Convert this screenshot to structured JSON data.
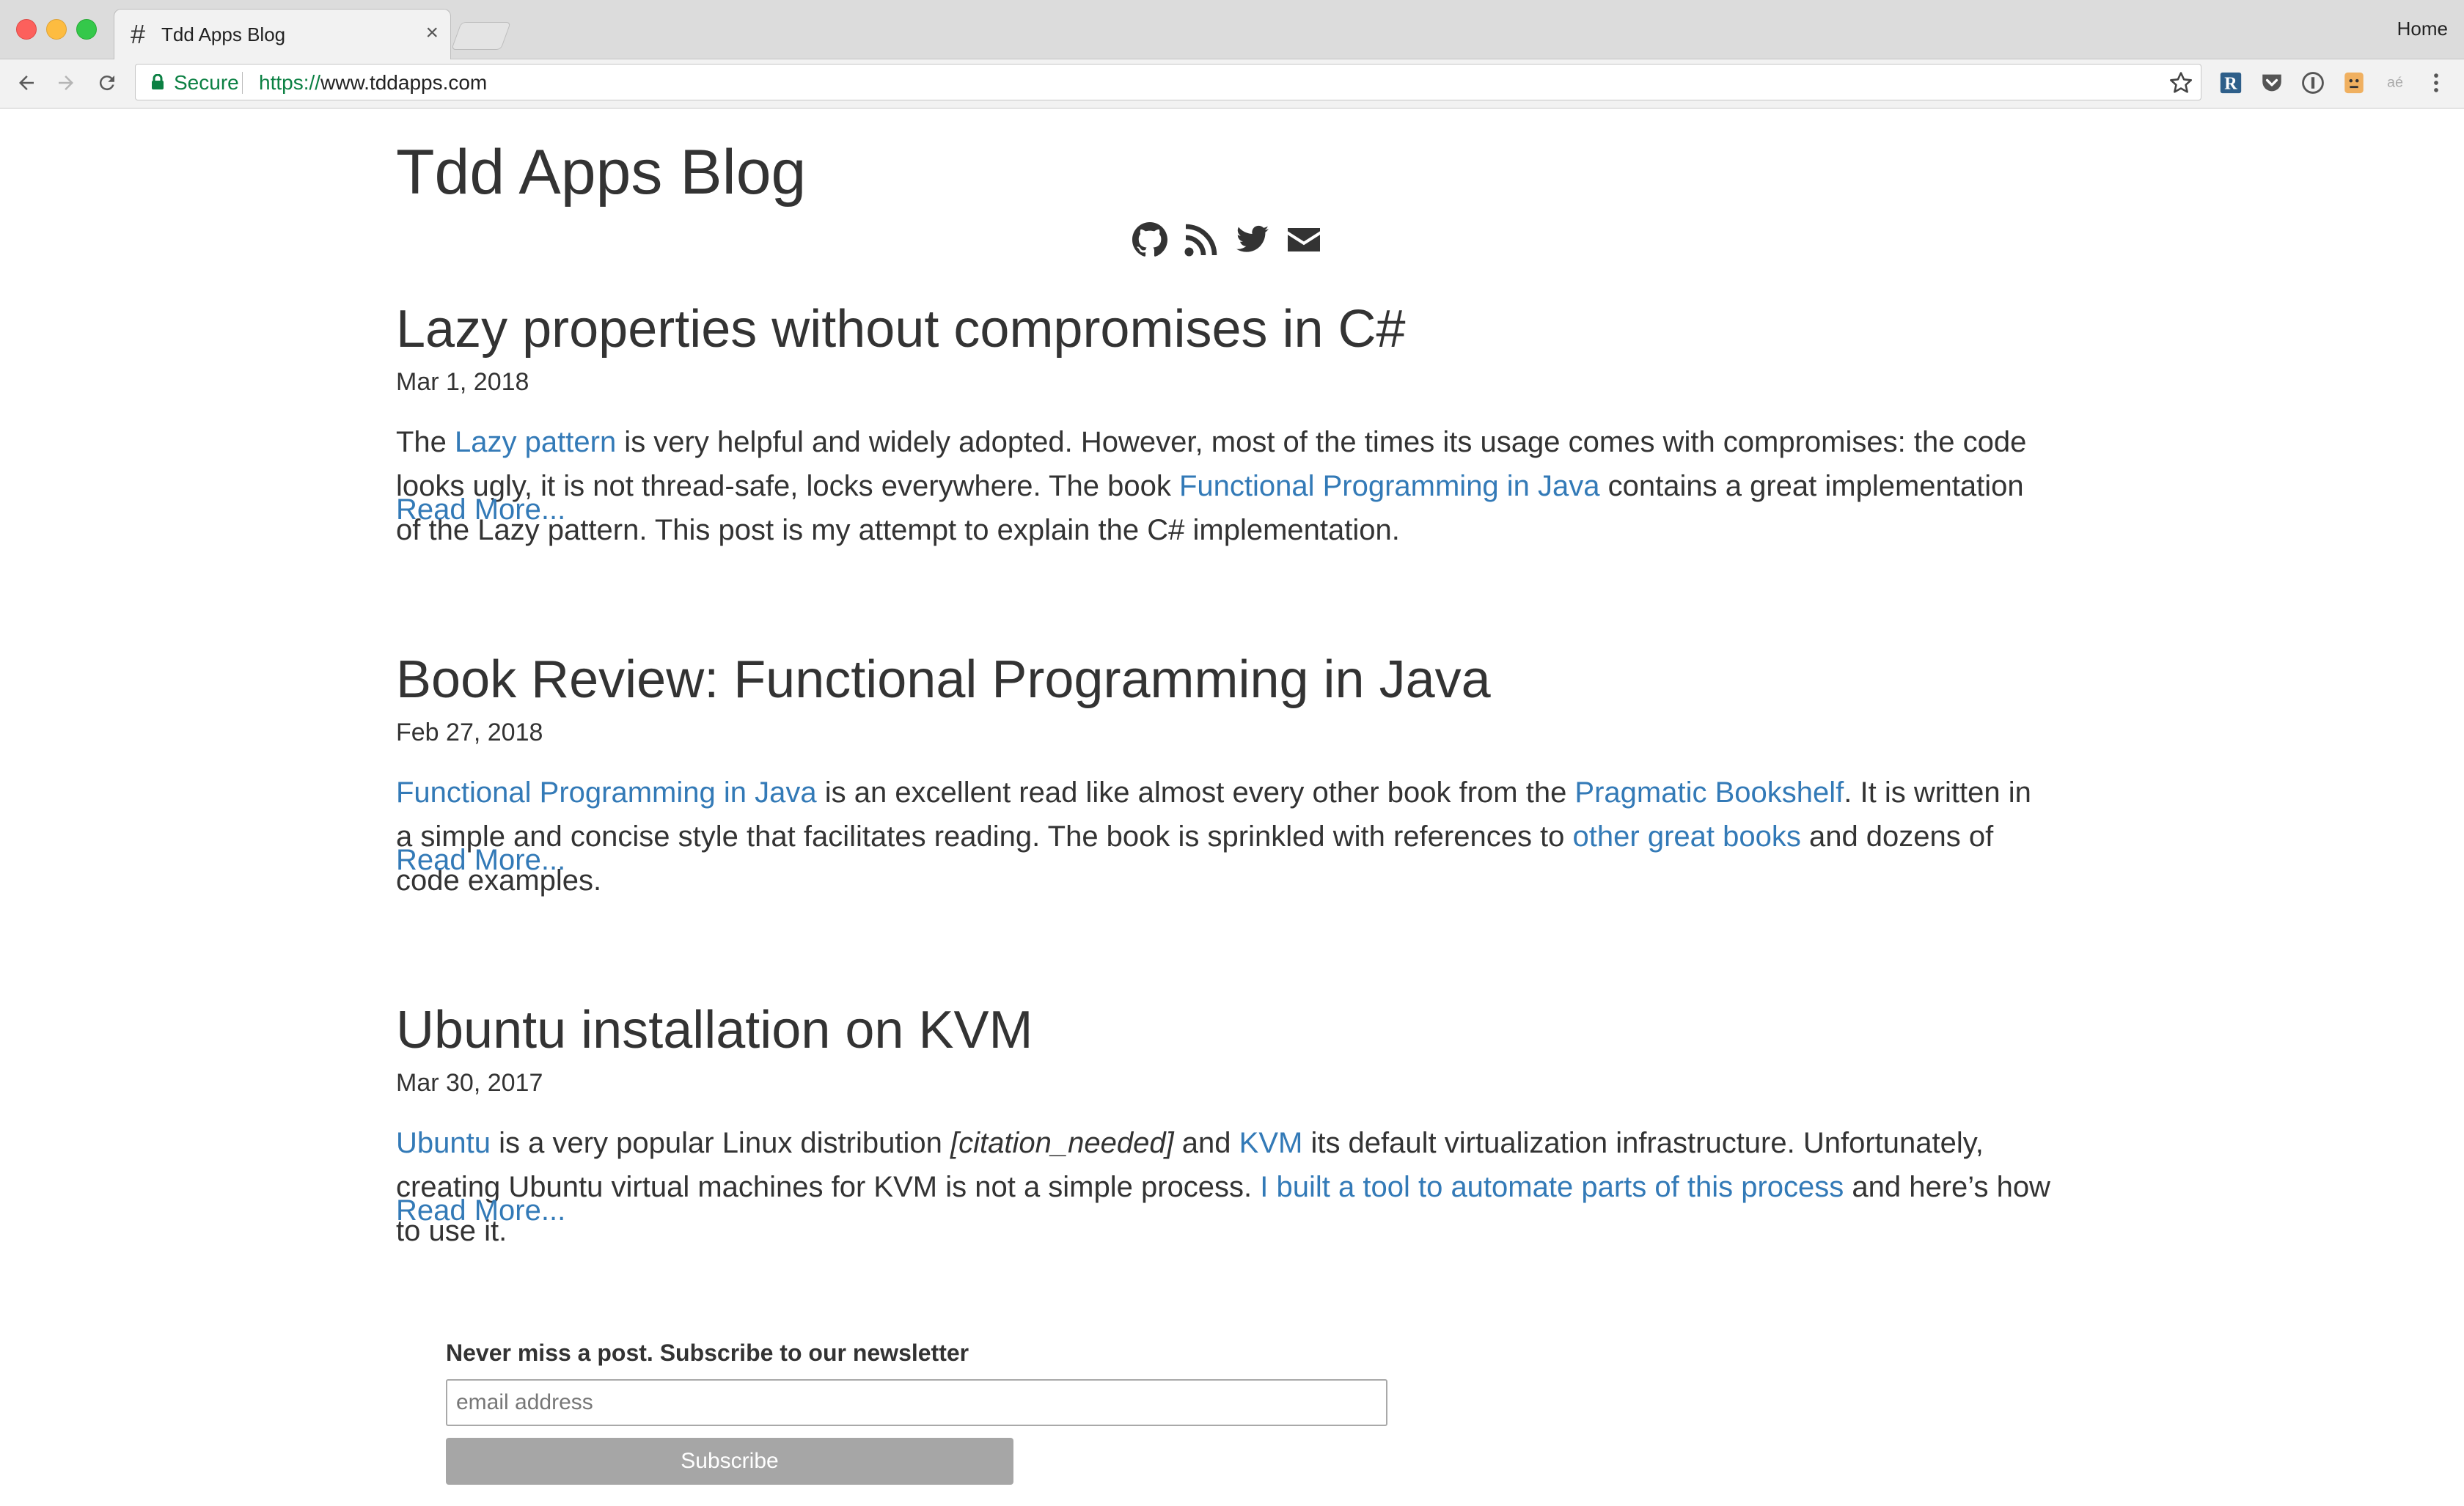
{
  "browser": {
    "tab_title": "Tdd Apps Blog",
    "tab_favicon": "#",
    "tab_close": "×",
    "profile_label": "Home",
    "secure_label": "Secure",
    "url_scheme": "https://",
    "url_host": "www.tddapps.com",
    "extensions": [
      "r-extension-icon",
      "pocket-icon",
      "password-manager-icon",
      "face-extension-icon",
      "text-extension-icon"
    ]
  },
  "blog": {
    "title": "Tdd Apps Blog",
    "social": [
      "github-icon",
      "rss-icon",
      "twitter-icon",
      "email-icon"
    ]
  },
  "posts": [
    {
      "title": "Lazy properties without compromises in C#",
      "date": "Mar 1, 2018",
      "excerpt": [
        {
          "text": "The "
        },
        {
          "text": "Lazy pattern",
          "link": true
        },
        {
          "text": " is very helpful and widely adopted. However, most of the times its usage comes with compromises: the code looks ugly, it is not thread-safe, locks everywhere. The book "
        },
        {
          "text": "Functional Programming in Java",
          "link": true
        },
        {
          "text": " contains a great implementation of the Lazy pattern. This post is my attempt to explain the C# implementation."
        }
      ],
      "read_more": "Read More..."
    },
    {
      "title": "Book Review: Functional Programming in Java",
      "date": "Feb 27, 2018",
      "excerpt": [
        {
          "text": "Functional Programming in Java",
          "link": true
        },
        {
          "text": " is an excellent read like almost every other book from the "
        },
        {
          "text": "Pragmatic Bookshelf",
          "link": true
        },
        {
          "text": ". It is written in a simple and concise style that facilitates reading. The book is sprinkled with references to "
        },
        {
          "text": "other great books",
          "link": true
        },
        {
          "text": " and dozens of code examples."
        }
      ],
      "read_more": "Read More..."
    },
    {
      "title": "Ubuntu installation on KVM",
      "date": "Mar 30, 2017",
      "excerpt": [
        {
          "text": "Ubuntu",
          "link": true
        },
        {
          "text": " is a very popular Linux distribution "
        },
        {
          "text": "[citation_needed]",
          "italic": true
        },
        {
          "text": " and "
        },
        {
          "text": "KVM",
          "link": true
        },
        {
          "text": " its default virtualization infrastructure. Unfortunately, creating Ubuntu virtual machines for KVM is not a simple process. "
        },
        {
          "text": "I built a tool to automate parts of this process",
          "link": true
        },
        {
          "text": " and here’s how to use it."
        }
      ],
      "read_more": "Read More..."
    }
  ],
  "newsletter": {
    "heading": "Never miss a post. Subscribe to our newsletter",
    "email_placeholder": "email address",
    "email_value": "",
    "subscribe_label": "Subscribe"
  },
  "colors": {
    "link": "#337ab7",
    "text": "#333333",
    "secure": "#0b8043",
    "button": "#a6a6a6"
  }
}
